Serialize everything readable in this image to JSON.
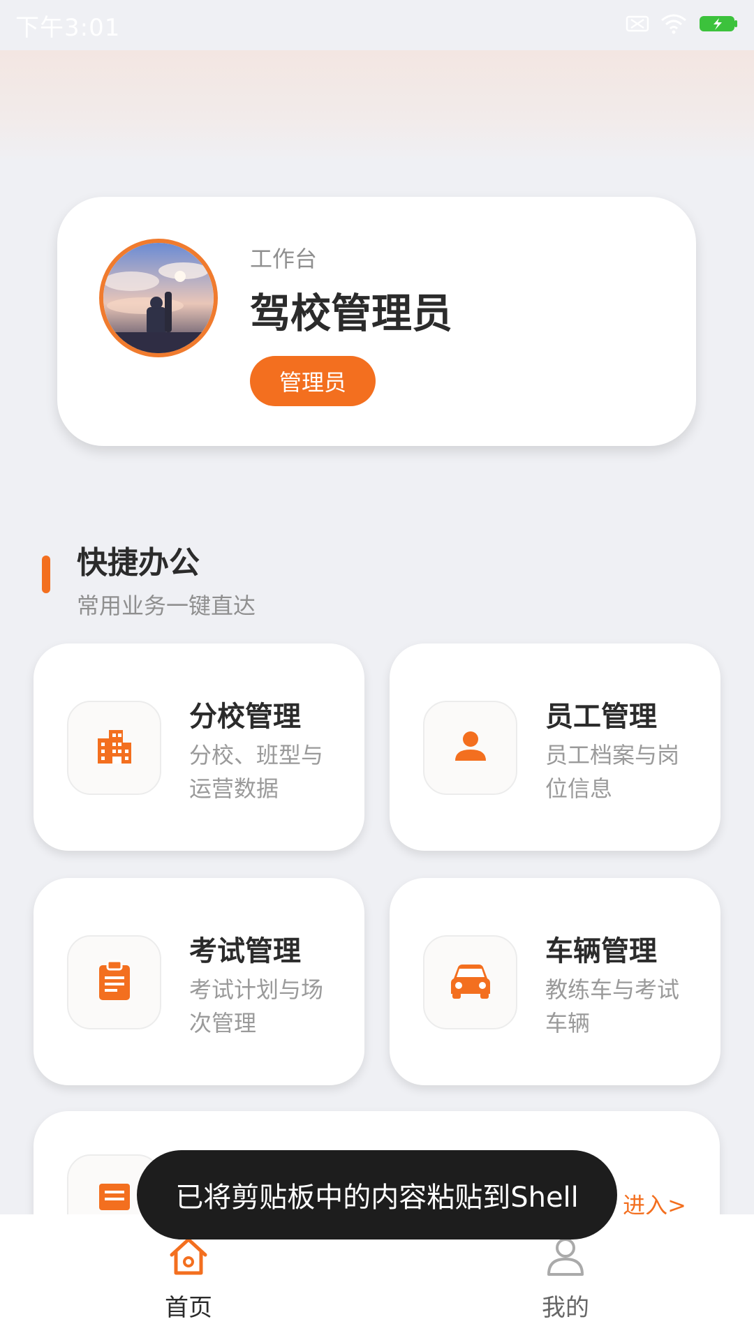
{
  "status_bar": {
    "time": "下午3:01"
  },
  "profile": {
    "workbench_label": "工作台",
    "name": "驾校管理员",
    "role": "管理员"
  },
  "section": {
    "title": "快捷办公",
    "subtitle": "常用业务一键直达"
  },
  "tiles": [
    {
      "title": "分校管理",
      "desc": "分校、班型与运营数据",
      "icon": "building-icon"
    },
    {
      "title": "员工管理",
      "desc": "员工档案与岗位信息",
      "icon": "person-icon"
    },
    {
      "title": "考试管理",
      "desc": "考试计划与场次管理",
      "icon": "clipboard-icon"
    },
    {
      "title": "车辆管理",
      "desc": "教练车与考试车辆",
      "icon": "car-icon"
    }
  ],
  "partial_tile": {
    "enter_text": "进入>"
  },
  "toast": {
    "text": "已将剪贴板中的内容粘贴到Shell"
  },
  "tab_bar": {
    "home": "首页",
    "mine": "我的"
  },
  "colors": {
    "accent": "#f36f1f",
    "background": "#eff0f4"
  }
}
